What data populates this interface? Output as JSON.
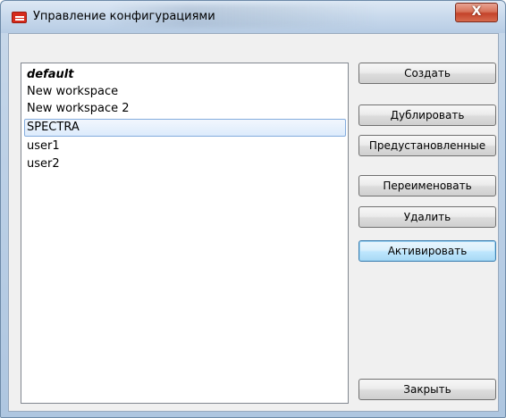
{
  "window": {
    "title": "Управление конфигурациями",
    "close_label": "X"
  },
  "configs": {
    "items": [
      {
        "label": "default",
        "style": "bold-italic"
      },
      {
        "label": "New workspace"
      },
      {
        "label": "New workspace 2"
      },
      {
        "label": "SPECTRA",
        "selected": true
      },
      {
        "label": "user1"
      },
      {
        "label": "user2"
      }
    ]
  },
  "buttons": {
    "create": "Создать",
    "duplicate": "Дублировать",
    "presets": "Предустановленные",
    "rename": "Переименовать",
    "delete": "Удалить",
    "activate": "Активировать",
    "close": "Закрыть"
  },
  "colors": {
    "app_icon": "#d62a1c",
    "selection_border": "#84acdd",
    "close_button": "#c4432a"
  }
}
